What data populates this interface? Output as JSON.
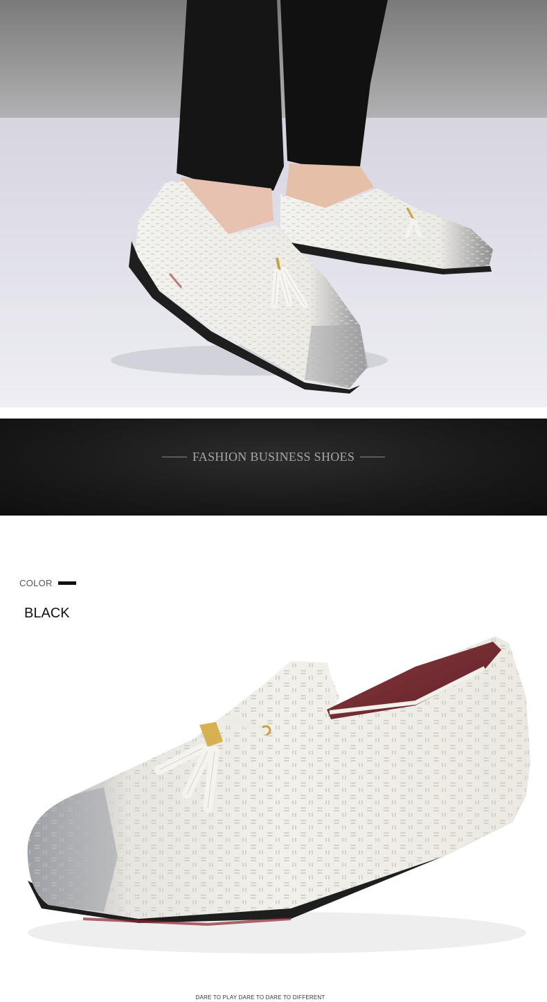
{
  "banner": {
    "title": "FASHION BUSINESS SHOES"
  },
  "color_section": {
    "label": "COLOR",
    "value": "BLACK"
  },
  "footer": {
    "slogan": "DARE TO PLAY DARE TO DARE TO DIFFERENT"
  },
  "colors": {
    "banner_bg": "#1a1a1a",
    "shoe_white": "#f2f0ea",
    "sole": "#1e1e1e",
    "trouser": "#151515",
    "lining": "#7a2a32"
  }
}
